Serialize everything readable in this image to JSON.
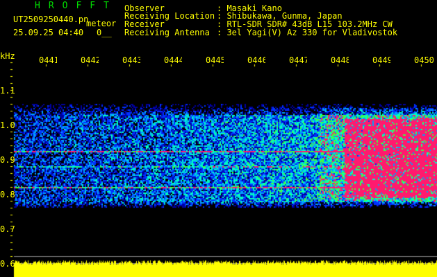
{
  "header": {
    "app_title": "HROFFT",
    "filename": "UT2509250440.pn",
    "mode": "meteor",
    "datetime": "25.09.25 04:40",
    "count": "0__",
    "info": [
      {
        "label": "Observer",
        "value": ": Masaki Kano"
      },
      {
        "label": "Receiving Location",
        "value": ": Shibukawa, Gunma, Japan"
      },
      {
        "label": "Receiver",
        "value": ": RTL-SDR SDR# 43dB L15 103.2MHz CW"
      },
      {
        "label": "Receiving Antenna",
        "value": ": 3el Yagi(V) Az 330 for Vladivostok"
      }
    ]
  },
  "axis": {
    "y_unit": "kHz",
    "y_labels": [
      "1.1",
      "1.0",
      "0.9",
      "0.8",
      "0.7",
      "0.6"
    ],
    "time_labels": [
      "0441",
      "0442",
      "0443",
      "0444",
      "0445",
      "0446",
      "0447",
      "0448",
      "0449",
      "0450"
    ]
  },
  "colors": {
    "text": "#ffff00",
    "title": "#00dd00",
    "signal_high": "#ff1a6e",
    "noise": "#0000a0"
  }
}
